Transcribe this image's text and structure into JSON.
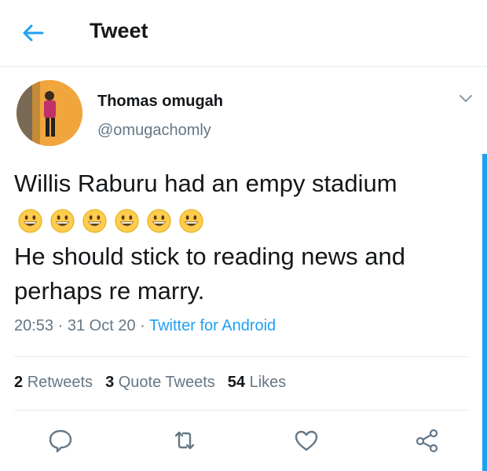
{
  "header": {
    "title": "Tweet"
  },
  "author": {
    "name": "Thomas omugah",
    "handle": "@omugachomly"
  },
  "tweet": {
    "line1": "Willis Raburu had an empy stadium",
    "emoji_count": 6,
    "emoji_name": "grinning-face-emoji",
    "line2": "He should stick to reading news and",
    "line3": "perhaps re marry."
  },
  "meta": {
    "time": "20:53",
    "separator": " · ",
    "date": "31 Oct 20",
    "source": "Twitter for Android"
  },
  "stats": {
    "retweets_count": "2",
    "retweets_label": "Retweets",
    "quotes_count": "3",
    "quotes_label": "Quote Tweets",
    "likes_count": "54",
    "likes_label": "Likes"
  },
  "colors": {
    "accent": "#1da1f2",
    "muted": "#657786",
    "text": "#14171a",
    "divider": "#e6ecf0"
  }
}
